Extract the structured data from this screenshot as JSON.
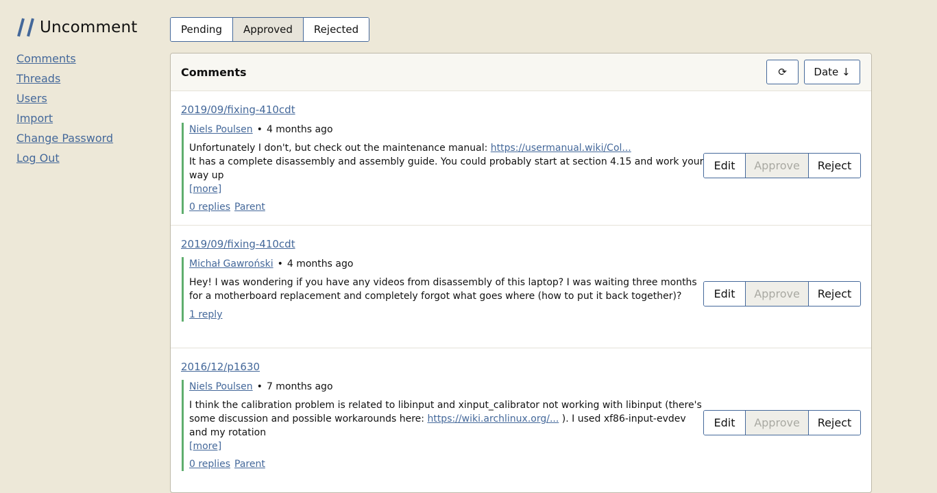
{
  "app": {
    "name": "Uncomment"
  },
  "nav": {
    "comments": "Comments",
    "threads": "Threads",
    "users": "Users",
    "import": "Import",
    "change_password": "Change Password",
    "log_out": "Log Out"
  },
  "tabs": {
    "pending": "Pending",
    "approved": "Approved",
    "rejected": "Rejected",
    "active": "Approved"
  },
  "panel": {
    "title": "Comments",
    "refresh_icon": "⟳",
    "sort_label": "Date ↓"
  },
  "comments": [
    {
      "thread": "2019/09/fixing-410cdt",
      "author": "Niels Poulsen",
      "sep": "•",
      "time": "4 months ago",
      "text1": "Unfortunately I don't, but check out the maintenance manual:",
      "link": "https://usermanual.wiki/Col...",
      "text2": "It has a complete disassembly and assembly guide. You could probably start at section 4.15 and work your way up",
      "more": "[more]",
      "replies": "0 replies",
      "parent": "Parent"
    },
    {
      "thread": "2019/09/fixing-410cdt",
      "author": "Michał Gawroński",
      "sep": "•",
      "time": "4 months ago",
      "text1": "Hey! I was wondering if you have any videos from disassembly of this laptop? I was waiting three months for a motherboard replacement and completely forgot what goes where (how to put it back together)?",
      "replies": "1 reply"
    },
    {
      "thread": "2016/12/p1630",
      "author": "Niels Poulsen",
      "sep": "•",
      "time": "7 months ago",
      "text1": "I think the calibration problem is related to libinput and xinput_calibrator not working with libinput (there's some discussion and possible workarounds here:",
      "link": "https://wiki.archlinux.org/...",
      "text2": "). I used xf86-input-evdev and my rotation",
      "more": "[more]",
      "replies": "0 replies",
      "parent": "Parent"
    }
  ],
  "actions": {
    "edit": "Edit",
    "approve": "Approve",
    "reject": "Reject"
  },
  "colors": {
    "link": "#44689a",
    "accent_border": "#5fae6e",
    "background": "#ede8d8"
  }
}
